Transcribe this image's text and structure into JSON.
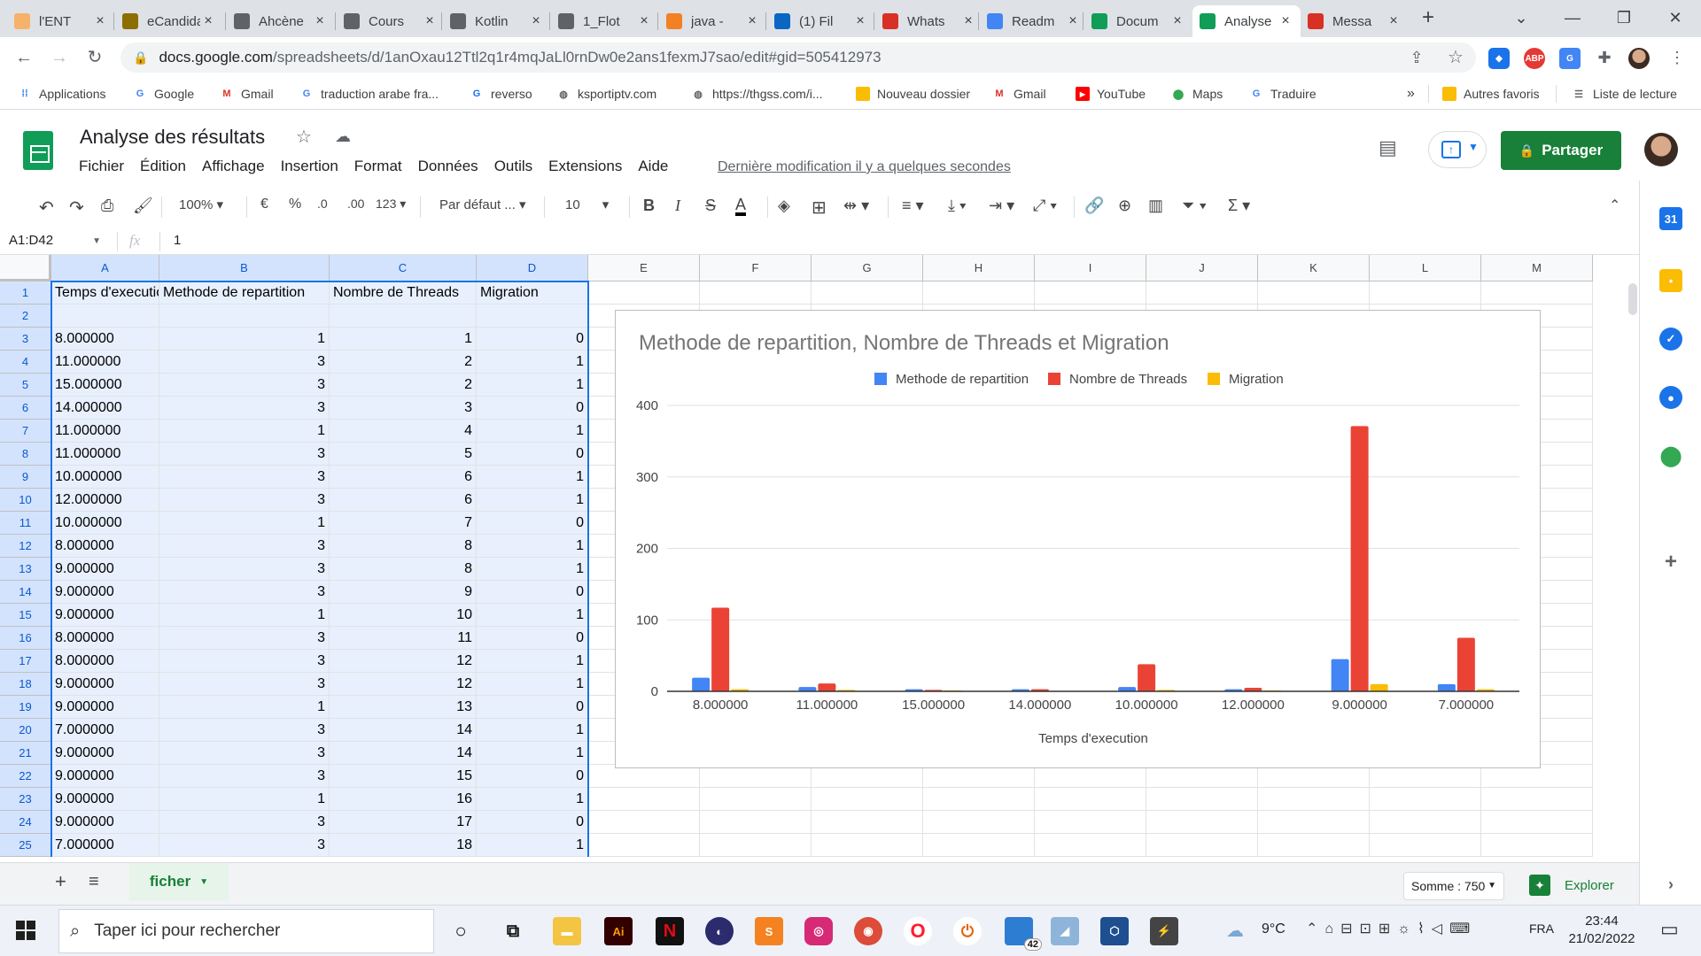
{
  "browser": {
    "tabs": [
      {
        "title": "l'ENT",
        "color": "#f6b26b"
      },
      {
        "title": "eCandidat",
        "color": "#8d6e00"
      },
      {
        "title": "Ahcène",
        "color": "#5f6368"
      },
      {
        "title": "Cours",
        "color": "#5f6368"
      },
      {
        "title": "Kotlin",
        "color": "#5f6368"
      },
      {
        "title": "1_Flot",
        "color": "#5f6368"
      },
      {
        "title": "java -",
        "color": "#f48024"
      },
      {
        "title": "(1) Fil",
        "color": "#0a66c2"
      },
      {
        "title": "Whats",
        "color": "#d93025"
      },
      {
        "title": "Readm",
        "color": "#4285f4"
      },
      {
        "title": "Docum",
        "color": "#0f9d58"
      },
      {
        "title": "Analyse",
        "color": "#0f9d58"
      },
      {
        "title": "Messa",
        "color": "#d93025"
      }
    ],
    "new_tab_label": "+",
    "url_host": "docs.google.com",
    "url_path": "/spreadsheets/d/1anOxau12Ttl2q1r4mqJaLl0rnDw0e2ans1fexmJ7sao/edit#gid=505412973",
    "bookmarks": [
      {
        "label": "Applications",
        "icon": "apps-icon",
        "color": "#1a73e8"
      },
      {
        "label": "Google",
        "icon": "google-icon",
        "color": "#4285f4"
      },
      {
        "label": "Gmail",
        "icon": "gmail-icon",
        "color": "#d93025"
      },
      {
        "label": "traduction arabe fra...",
        "icon": "google-icon",
        "color": "#4285f4"
      },
      {
        "label": "reverso",
        "icon": "reverso-icon",
        "color": "#1a73e8"
      },
      {
        "label": "ksportiptv.com",
        "icon": "globe-icon",
        "color": "#5f6368"
      },
      {
        "label": "https://thgss.com/i...",
        "icon": "globe-icon",
        "color": "#5f6368"
      },
      {
        "label": "Nouveau dossier",
        "icon": "folder-icon",
        "color": "#fbbc04"
      },
      {
        "label": "Gmail",
        "icon": "gmail-icon",
        "color": "#d93025"
      },
      {
        "label": "YouTube",
        "icon": "youtube-icon",
        "color": "#ff0000"
      },
      {
        "label": "Maps",
        "icon": "maps-icon",
        "color": "#34a853"
      },
      {
        "label": "Traduire",
        "icon": "translate-icon",
        "color": "#4285f4"
      }
    ],
    "bookmarks_more": "»",
    "other_bookmarks": "Autres favoris",
    "reading_list": "Liste de lecture"
  },
  "doc": {
    "title": "Analyse des résultats",
    "menu": [
      "Fichier",
      "Édition",
      "Affichage",
      "Insertion",
      "Format",
      "Données",
      "Outils",
      "Extensions",
      "Aide"
    ],
    "last_modified": "Dernière modification il y a quelques secondes",
    "share_label": "Partager"
  },
  "toolbar": {
    "zoom": "100%",
    "currency": "€",
    "percent": "%",
    "dec_decrease": ".0",
    "dec_increase": ".00",
    "more_formats": "123",
    "font": "Par défaut ...",
    "font_size": "10",
    "bold": "B",
    "italic": "I",
    "strike": "S",
    "text_color": "A",
    "functions": "Σ"
  },
  "formula": {
    "name_box": "A1:D42",
    "fx": "fx",
    "value": "1"
  },
  "grid": {
    "columns": [
      "A",
      "B",
      "C",
      "D",
      "E",
      "F",
      "G",
      "H",
      "I",
      "J",
      "K",
      "L",
      "M"
    ],
    "headers": [
      "Temps d'execution",
      "Methode de repartition",
      "Nombre de Threads",
      "Migration"
    ],
    "rows": [
      [
        "8.000000",
        "1",
        "1",
        "0"
      ],
      [
        "11.000000",
        "3",
        "2",
        "1"
      ],
      [
        "15.000000",
        "3",
        "2",
        "1"
      ],
      [
        "14.000000",
        "3",
        "3",
        "0"
      ],
      [
        "11.000000",
        "1",
        "4",
        "1"
      ],
      [
        "11.000000",
        "3",
        "5",
        "0"
      ],
      [
        "10.000000",
        "3",
        "6",
        "1"
      ],
      [
        "12.000000",
        "3",
        "6",
        "1"
      ],
      [
        "10.000000",
        "1",
        "7",
        "0"
      ],
      [
        "8.000000",
        "3",
        "8",
        "1"
      ],
      [
        "9.000000",
        "3",
        "8",
        "1"
      ],
      [
        "9.000000",
        "3",
        "9",
        "0"
      ],
      [
        "9.000000",
        "1",
        "10",
        "1"
      ],
      [
        "8.000000",
        "3",
        "11",
        "0"
      ],
      [
        "8.000000",
        "3",
        "12",
        "1"
      ],
      [
        "9.000000",
        "3",
        "12",
        "1"
      ],
      [
        "9.000000",
        "1",
        "13",
        "0"
      ],
      [
        "7.000000",
        "3",
        "14",
        "1"
      ],
      [
        "9.000000",
        "3",
        "14",
        "1"
      ],
      [
        "9.000000",
        "3",
        "15",
        "0"
      ],
      [
        "9.000000",
        "1",
        "16",
        "1"
      ],
      [
        "9.000000",
        "3",
        "17",
        "0"
      ],
      [
        "7.000000",
        "3",
        "18",
        "1"
      ]
    ]
  },
  "chart_data": {
    "type": "bar",
    "title": "Methode de repartition, Nombre de Threads et Migration",
    "xlabel": "Temps d'execution",
    "ylabel": "",
    "categories": [
      "8.000000",
      "11.000000",
      "15.000000",
      "14.000000",
      "10.000000",
      "12.000000",
      "9.000000",
      "7.000000"
    ],
    "series": [
      {
        "name": "Methode de repartition",
        "color": "#4285f4",
        "values": [
          19,
          6,
          3,
          3,
          6,
          3,
          45,
          10
        ]
      },
      {
        "name": "Nombre de Threads",
        "color": "#ea4335",
        "values": [
          117,
          11,
          2,
          3,
          38,
          5,
          371,
          75
        ]
      },
      {
        "name": "Migration",
        "color": "#fbbc04",
        "values": [
          3,
          2,
          1,
          0,
          2,
          1,
          10,
          3
        ]
      }
    ],
    "ylim": [
      0,
      400
    ],
    "yticks": [
      "0",
      "100",
      "200",
      "300",
      "400"
    ],
    "grid": true,
    "legend": "top"
  },
  "sheets": {
    "add": "+",
    "tab_name": "ficher",
    "sum": "Somme : 750",
    "explore": "Explorer"
  },
  "taskbar": {
    "search_placeholder": "Taper ici pour rechercher",
    "weather": "9°C",
    "lang": "FRA",
    "time": "23:44",
    "date": "21/02/2022",
    "badge": "42"
  }
}
